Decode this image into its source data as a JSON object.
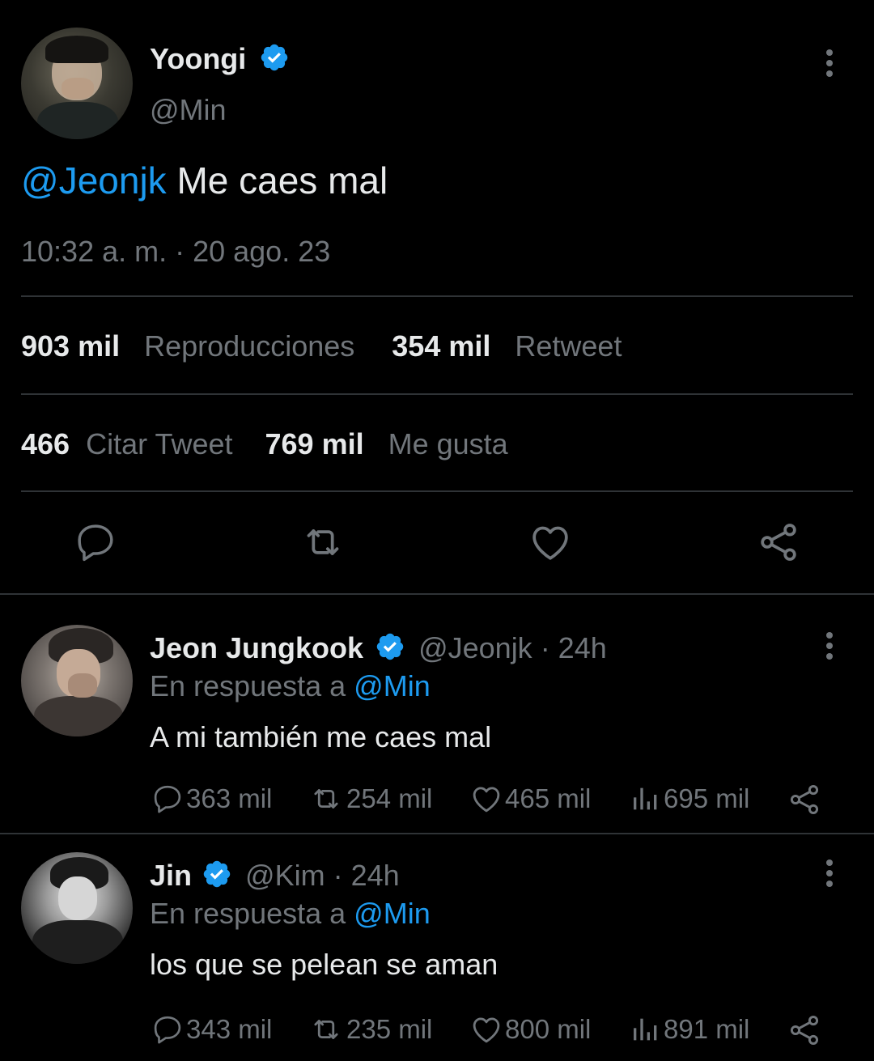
{
  "tweet": {
    "author_name": "Yoongi",
    "author_handle": "@Min",
    "mention": "@Jeonjk",
    "text": " Me caes mal",
    "timestamp": "10:32 a. m. · 20 ago. 23",
    "stats": {
      "views_value": "903 mil",
      "views_label": "Reproducciones",
      "retweets_value": "354 mil",
      "retweets_label": "Retweet",
      "quotes_value": "466",
      "quotes_label": "Citar Tweet",
      "likes_value": "769 mil",
      "likes_label": "Me gusta"
    }
  },
  "replies": [
    {
      "name": "Jeon Jungkook",
      "handle": "@Jeonjk",
      "age": " · 24h",
      "in_reply_prefix": "En respuesta a ",
      "in_reply_handle": "@Min",
      "text": "A mi también me caes mal",
      "replies": "363 mil",
      "retweets": "254 mil",
      "likes": "465 mil",
      "views": "695 mil"
    },
    {
      "name": "Jin",
      "handle": "@Kim",
      "age": " · 24h",
      "in_reply_prefix": "En respuesta a ",
      "in_reply_handle": "@Min",
      "text": "los que se pelean se aman",
      "replies": "343 mil",
      "retweets": "235 mil",
      "likes": "800 mil",
      "views": "891 mil"
    }
  ],
  "colors": {
    "background": "#000000",
    "text": "#e7e9ea",
    "muted": "#71767b",
    "accent": "#1d9bf0",
    "divider": "#2f3336"
  },
  "icons": [
    "verified-badge-icon",
    "more-options-icon",
    "reply-icon",
    "retweet-icon",
    "like-icon",
    "share-icon",
    "views-icon"
  ]
}
